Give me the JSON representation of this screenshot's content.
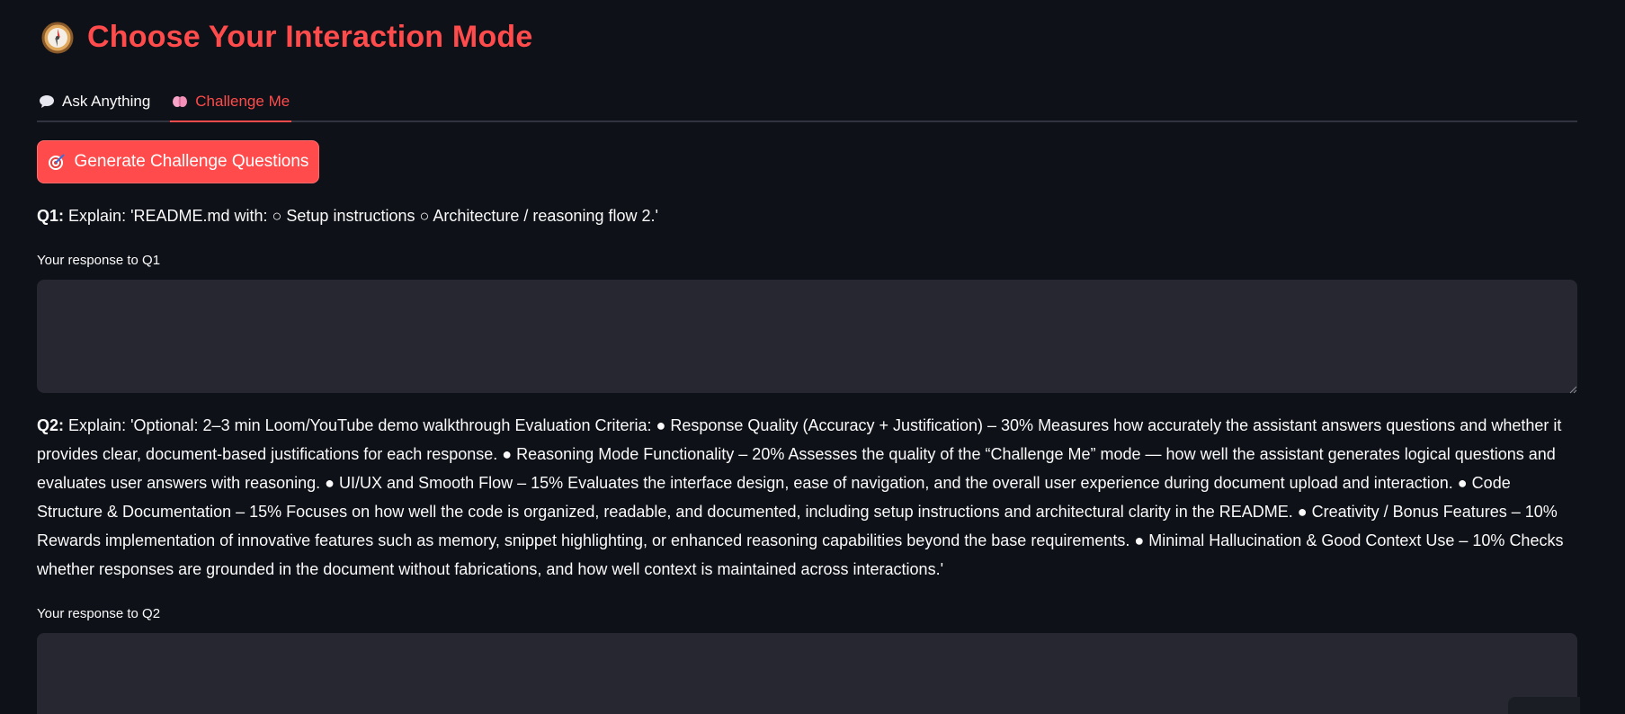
{
  "header": {
    "icon": "compass-icon",
    "title": "Choose Your Interaction Mode"
  },
  "tabs": [
    {
      "icon": "speech-bubble-icon",
      "label": "Ask Anything",
      "active": false
    },
    {
      "icon": "brain-icon",
      "label": "Challenge Me",
      "active": true
    }
  ],
  "generate_button": {
    "icon": "target-icon",
    "label": "Generate Challenge Questions"
  },
  "questions": [
    {
      "number": "Q1:",
      "text": "Explain: 'README.md with: ○ Setup instructions ○ Architecture / reasoning flow 2.'",
      "response_label": "Your response to Q1",
      "response_value": ""
    },
    {
      "number": "Q2:",
      "text": "Explain: 'Optional: 2–3 min Loom/YouTube demo walkthrough Evaluation Criteria: ● Response Quality (Accuracy + Justification) – 30% Measures how accurately the assistant answers questions and whether it provides clear, document-based justifications for each response. ● Reasoning Mode Functionality – 20% Assesses the quality of the “Challenge Me” mode — how well the assistant generates logical questions and evaluates user answers with reasoning. ● UI/UX and Smooth Flow – 15% Evaluates the interface design, ease of navigation, and the overall user experience during document upload and interaction. ● Code Structure & Documentation – 15% Focuses on how well the code is organized, readable, and documented, including setup instructions and architectural clarity in the README. ● Creativity / Bonus Features – 10% Rewards implementation of innovative features such as memory, snippet highlighting, or enhanced reasoning capabilities beyond the base requirements. ● Minimal Hallucination & Good Context Use – 10% Checks whether responses are grounded in the document without fabrications, and how well context is maintained across interactions.'",
      "response_label": "Your response to Q2",
      "response_value": ""
    }
  ],
  "colors": {
    "background": "#0e1117",
    "accent": "#ff4b4b",
    "input_bg": "#262730",
    "text": "#fafafa"
  }
}
